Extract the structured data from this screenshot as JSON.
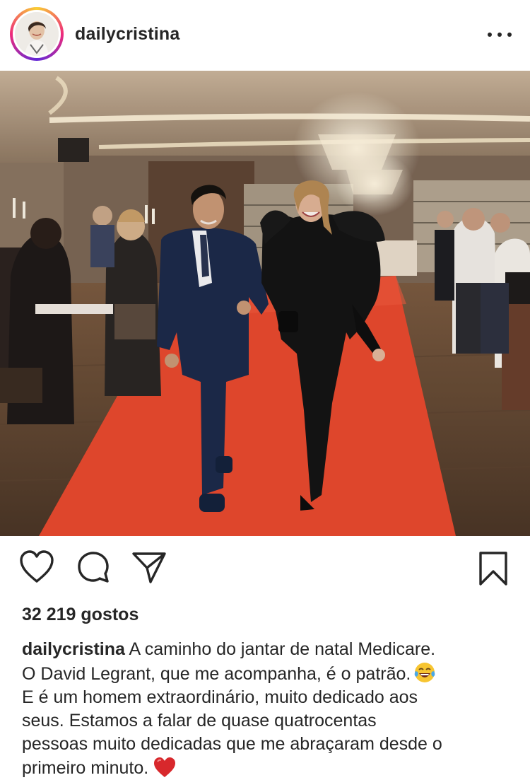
{
  "post": {
    "username": "dailycristina",
    "more_icon": "more-horizontal-icon",
    "image_alt": "",
    "likes_text": "32 219 gostos",
    "caption": {
      "username": "dailycristina",
      "lines": [
        "A caminho do jantar de natal Medicare.",
        "O David Legrant, que me acompanha, é o patrão.",
        "E é um homem extraordinário, muito dedicado aos",
        "seus. Estamos a falar de quase quatrocentas",
        "pessoas muito dedicadas que me abraçaram desde o",
        "primeiro minuto."
      ],
      "emoji_line2": "face-with-tears-of-joy",
      "emoji_line6": "red-heart"
    }
  },
  "actions": {
    "like_icon": "heart-icon",
    "comment_icon": "comment-icon",
    "share_icon": "paper-plane-icon",
    "save_icon": "bookmark-icon"
  },
  "colors": {
    "text": "#262626",
    "heart_red": "#d8282c",
    "carpet": "#e8492e",
    "ring_gradient": [
      "#f9ce34",
      "#ee2a7b",
      "#6228d7"
    ]
  }
}
